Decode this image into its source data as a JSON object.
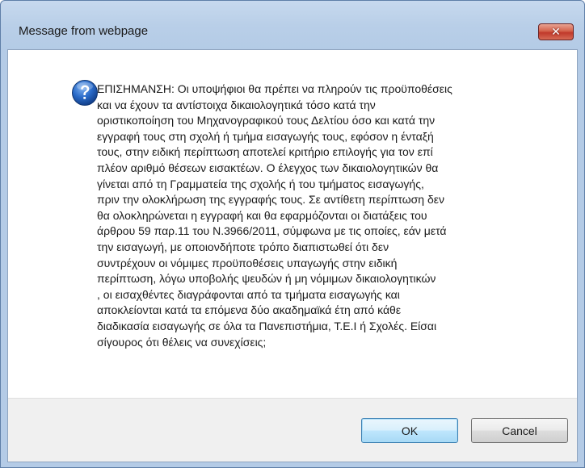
{
  "window": {
    "title": "Message from webpage"
  },
  "titlebar": {
    "close_symbol": "✕"
  },
  "dialog": {
    "icon": "question-icon",
    "message_lines": [
      "ΕΠΙΣΗΜΑΝΣΗ: Οι υποψήφιοι θα πρέπει να πληρούν τις προϋποθέσεις",
      "και να έχουν τα αντίστοιχα δικαιολογητικά τόσο κατά την",
      "οριστικοποίηση  του Μηχανογραφικού τους Δελτίου όσο και κατά την",
      "εγγραφή τους στη σχολή ή τμήμα εισαγωγής τους, εφόσον η ένταξή",
      "τους, στην ειδική περίπτωση αποτελεί κριτήριο επιλογής για τον επί",
      "πλέον αριθμό θέσεων εισακτέων. Ο έλεγχος των δικαιολογητικών θα",
      "γίνεται από τη Γραμματεία της σχολής ή του τμήματος εισαγωγής,",
      "πριν την ολοκλήρωση της εγγραφής τους. Σε αντίθετη περίπτωση δεν",
      "θα ολοκληρώνεται η εγγραφή και θα εφαρμόζονται οι διατάξεις του",
      "άρθρου 59 παρ.11 του Ν.3966/2011, σύμφωνα με τις οποίες, εάν μετά",
      "την εισαγωγή, με οποιονδήποτε τρόπο διαπιστωθεί ότι δεν",
      "συντρέχουν οι νόμιμες προϋποθέσεις υπαγωγής στην ειδική",
      "περίπτωση, λόγω υποβολής ψευδών ή μη νόμιμων δικαιολογητικών",
      ", οι εισαχθέντες διαγράφονται από τα τμήματα εισαγωγής και",
      "αποκλείονται κατά τα επόμενα δύο ακαδημαϊκά έτη από κάθε",
      "διαδικασία εισαγωγής σε όλα τα Πανεπιστήμια, Τ.Ε.Ι ή Σχολές. Είσαι",
      "σίγουρος ότι θέλεις να συνεχίσεις;"
    ],
    "message": ""
  },
  "buttons": {
    "ok_label": "OK",
    "cancel_label": "Cancel"
  },
  "colors": {
    "titlebar": "#b9cfe8",
    "close_button": "#c0392b",
    "button_bar": "#f0f0f0",
    "icon_blue": "#1f5fb8"
  }
}
